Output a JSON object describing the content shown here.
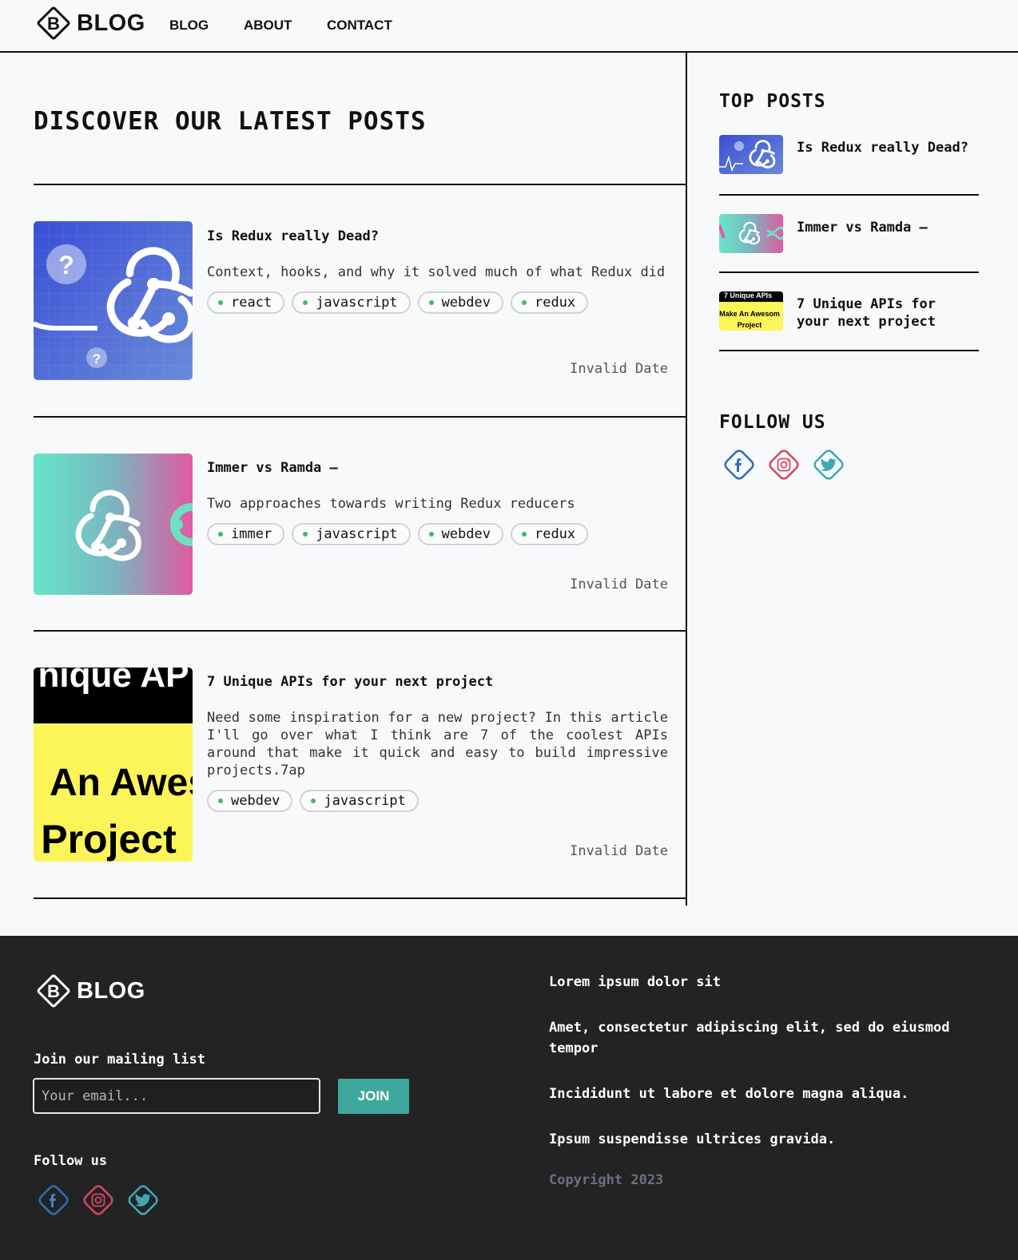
{
  "header": {
    "logo_letter": "B",
    "logo_text": "BLOG",
    "nav": [
      "BLOG",
      "ABOUT",
      "CONTACT"
    ]
  },
  "main": {
    "title": "DISCOVER OUR LATEST POSTS",
    "posts": [
      {
        "title": "Is Redux really Dead?",
        "description": "Context, hooks, and why it solved much of what Redux did",
        "tags": [
          "react",
          "javascript",
          "webdev",
          "redux"
        ],
        "date": "Invalid Date"
      },
      {
        "title": "Immer vs Ramda –",
        "description": "Two approaches towards writing Redux reducers",
        "tags": [
          "immer",
          "javascript",
          "webdev",
          "redux"
        ],
        "date": "Invalid Date"
      },
      {
        "title": "7 Unique APIs for your next project",
        "description": "Need some inspiration for a new project? In this article I'll go over what I think are 7 of the coolest APIs around that make it quick and easy to build impressive projects.7ap",
        "tags": [
          "webdev",
          "javascript"
        ],
        "date": "Invalid Date",
        "thumb_text": [
          "nique AP",
          "An Awes",
          "Project"
        ]
      }
    ]
  },
  "sidebar": {
    "top_posts_heading": "TOP POSTS",
    "top_posts": [
      {
        "title": "Is Redux really Dead?"
      },
      {
        "title": "Immer vs Ramda –"
      },
      {
        "title": "7 Unique APIs for your next project",
        "thumb_text": [
          "7 Unique APIs",
          "Make An Awesom",
          "Project"
        ]
      }
    ],
    "follow_heading": "FOLLOW US",
    "social": [
      "facebook-icon",
      "instagram-icon",
      "twitter-icon"
    ]
  },
  "footer": {
    "logo_letter": "B",
    "logo_text": "BLOG",
    "mailing_label": "Join our mailing list",
    "email_placeholder": "Your email...",
    "join_label": "JOIN",
    "follow_label": "Follow us",
    "links": [
      "Lorem ipsum dolor sit",
      "Amet, consectetur adipiscing elit, sed do eiusmod tempor",
      "Incididunt ut labore et dolore magna aliqua.",
      "Ipsum suspendisse ultrices gravida."
    ],
    "copyright": "Copyright 2023"
  },
  "colors": {
    "facebook": "#2f6fb3",
    "instagram": "#d9465f",
    "twitter": "#3fa8b8",
    "tag_dot": "#3bbd6a",
    "join_button": "#3fa89c",
    "footer_bg": "#232323"
  }
}
